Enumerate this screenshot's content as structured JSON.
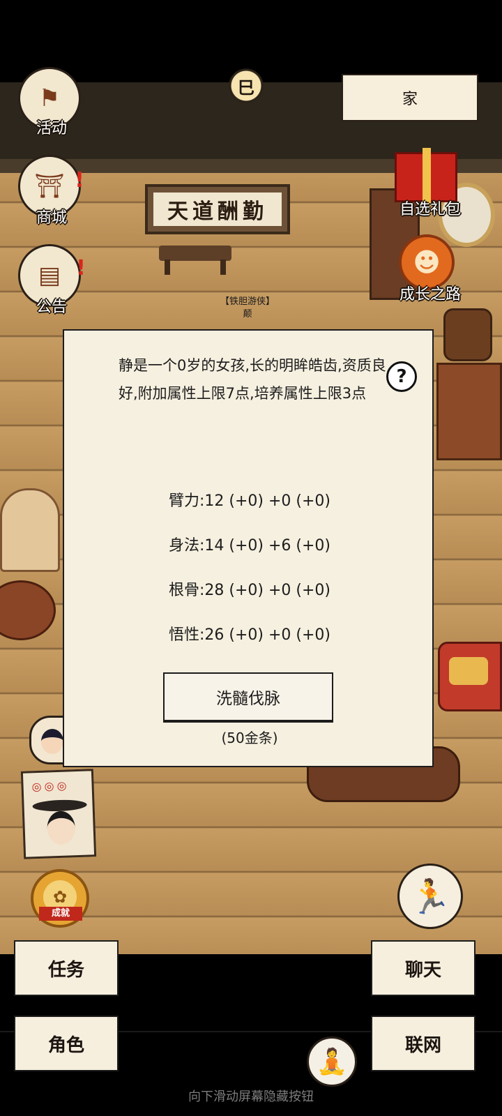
{
  "top": {
    "sun_icon_glyph": "巳",
    "home_label": "家"
  },
  "left_menu": {
    "activity_label": "活动",
    "shop_label": "商城",
    "notice_label": "公告"
  },
  "right_menu": {
    "gift_label": "自选礼包",
    "growth_label": "成长之路"
  },
  "scene": {
    "plaque_text": "天道酬勤",
    "npc_title": "【铁胆游侠】",
    "npc_name": "颠",
    "achievement_ribbon": "成就"
  },
  "dialog": {
    "description": "静是一个0岁的女孩,长的明眸皓齿,资质良好,附加属性上限7点,培养属性上限3点",
    "help_glyph": "?",
    "stats": [
      "臂力:12 (+0) +0 (+0)",
      "身法:14 (+0) +6 (+0)",
      "根骨:28 (+0) +0 (+0)",
      "悟性:26 (+0) +0 (+0)"
    ],
    "action_label": "洗髓伐脉",
    "action_cost": "(50金条)"
  },
  "bottom_bar": {
    "task_label": "任务",
    "chat_label": "聊天",
    "role_label": "角色",
    "online_label": "联网"
  },
  "hint_text": "向下滑动屏幕隐藏按钮",
  "colors": {
    "panel": "#f6f0e0",
    "floor": "#c69c62",
    "badge_red": "#d9261c"
  }
}
